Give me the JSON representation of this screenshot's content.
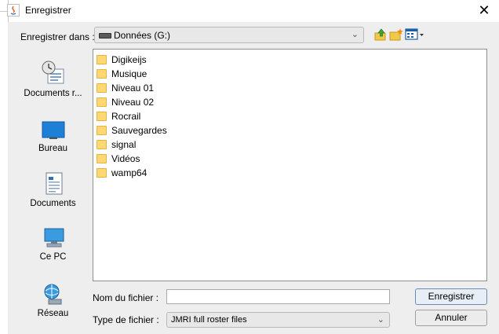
{
  "window": {
    "title": "Enregistrer",
    "close_glyph": "✕"
  },
  "toolbar": {
    "save_in_label": "Enregistrer dans :",
    "save_in_value": "Données (G:)",
    "up_icon": "up-folder-icon",
    "new_folder_icon": "new-folder-icon",
    "view_icon": "view-menu-icon"
  },
  "places": [
    {
      "label": "Documents r...",
      "icon": "recent-documents-icon"
    },
    {
      "label": "Bureau",
      "icon": "desktop-icon"
    },
    {
      "label": "Documents",
      "icon": "documents-icon"
    },
    {
      "label": "Ce PC",
      "icon": "computer-icon"
    },
    {
      "label": "Réseau",
      "icon": "network-icon"
    }
  ],
  "files": [
    "Digikeijs",
    "Musique",
    "Niveau 01",
    "Niveau 02",
    "Rocrail",
    "Sauvegardes",
    "signal",
    "Vidéos",
    "wamp64"
  ],
  "form": {
    "file_name_label": "Nom du fichier :",
    "file_name_value": "",
    "file_type_label": "Type de fichier :",
    "file_type_value": "JMRI full roster files"
  },
  "buttons": {
    "save": "Enregistrer",
    "cancel": "Annuler"
  },
  "colors": {
    "folder": "#ffd876",
    "accent": "#1e7fd6"
  }
}
